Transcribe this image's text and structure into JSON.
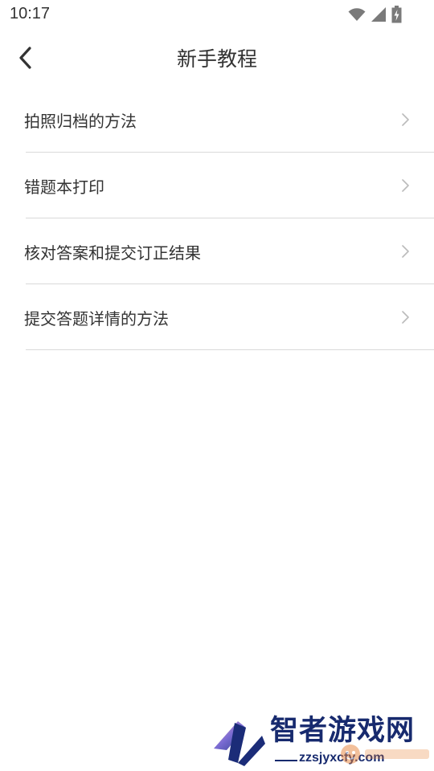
{
  "status_bar": {
    "time": "10:17",
    "icons": [
      "wifi-icon",
      "cell-signal-icon",
      "battery-charging-icon"
    ]
  },
  "header": {
    "back_icon": "chevron-left-icon",
    "title": "新手教程"
  },
  "menu": {
    "items": [
      {
        "label": "拍照归档的方法"
      },
      {
        "label": "错题本打印"
      },
      {
        "label": "核对答案和提交订正结果"
      },
      {
        "label": "提交答题详情的方法"
      }
    ],
    "chevron_icon": "chevron-right-icon"
  },
  "watermark": {
    "name": "智者游戏网",
    "domain": "zzsjyxcfy.com",
    "stamp_text": "单机100网"
  },
  "colors": {
    "text": "#333333",
    "divider": "#d9d9d9",
    "chevron": "#bbbbbb",
    "watermark": "#172a6e"
  }
}
